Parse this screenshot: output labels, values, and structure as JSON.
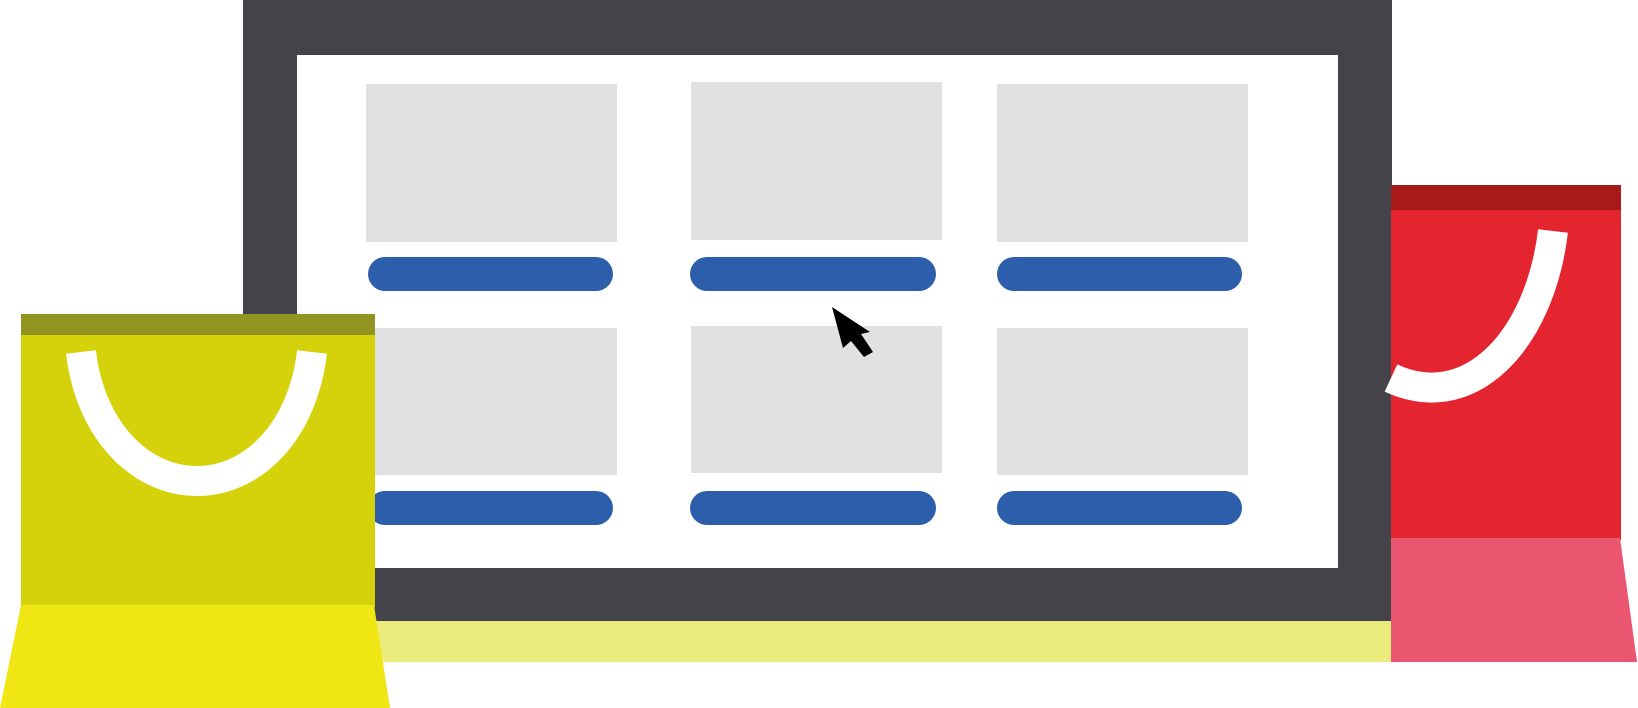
{
  "colors": {
    "background": "#ffffff",
    "monitor_frame": "#45434a",
    "screen": "#ffffff",
    "placeholder": "#e1e1e1",
    "button": "#2c5eab",
    "desk": "#eaea7d",
    "cursor": "#000000",
    "bag_left_body": "#d5d20b",
    "bag_left_band": "#929422",
    "bag_left_bottom": "#f0e613",
    "bag_right_body": "#e4252f",
    "bag_right_band": "#a81a19",
    "bag_right_bottom": "#ea5570",
    "bag_handle": "#ffffff"
  },
  "icons": {
    "cursor": "arrow-pointer-icon",
    "bag_left": "shopping-bag-icon",
    "bag_right": "shopping-bag-icon"
  },
  "product_grid": {
    "rows": 2,
    "columns": 3,
    "cards": [
      {
        "image": "image-placeholder",
        "button_label": ""
      },
      {
        "image": "image-placeholder",
        "button_label": ""
      },
      {
        "image": "image-placeholder",
        "button_label": ""
      },
      {
        "image": "image-placeholder",
        "button_label": ""
      },
      {
        "image": "image-placeholder",
        "button_label": ""
      },
      {
        "image": "image-placeholder",
        "button_label": ""
      }
    ]
  }
}
